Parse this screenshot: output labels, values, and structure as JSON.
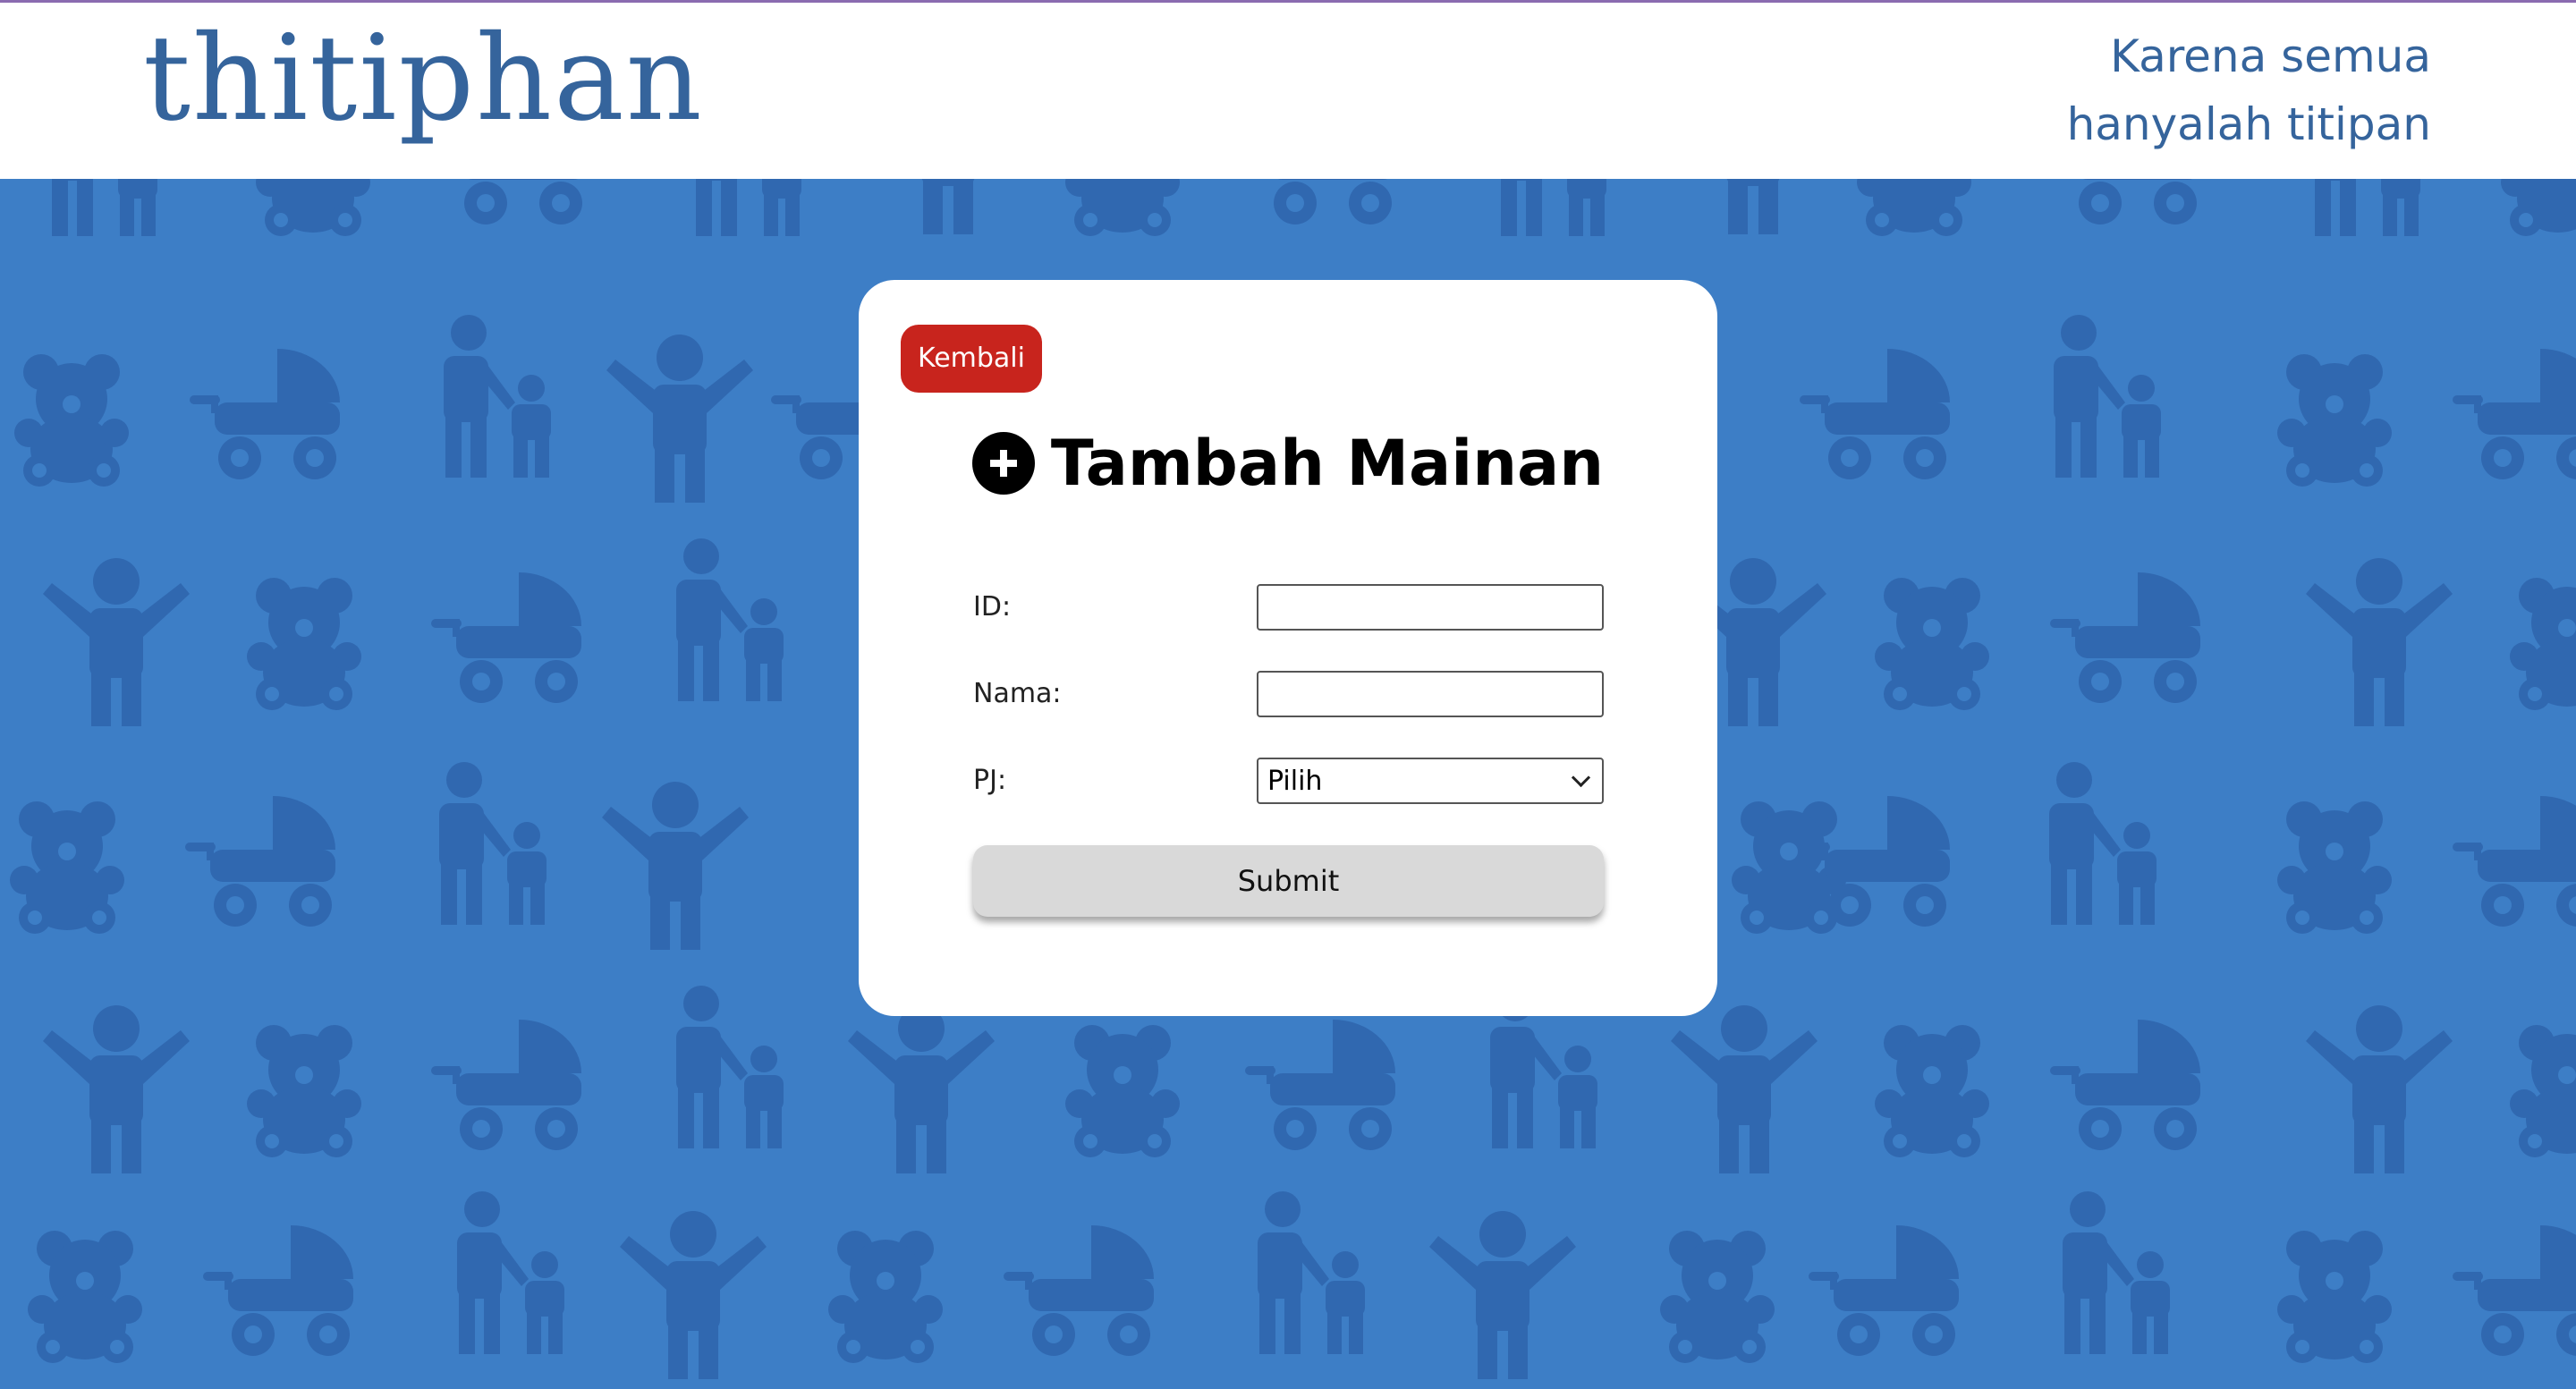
{
  "header": {
    "logo_text": "thitiphan",
    "tagline_line1": "Karena semua",
    "tagline_line2": "hanyalah titipan"
  },
  "card": {
    "back_button_label": "Kembali",
    "title": "Tambah Mainan",
    "title_icon": "plus-circle-icon",
    "fields": {
      "id_label": "ID:",
      "id_value": "",
      "nama_label": "Nama:",
      "nama_value": "",
      "pj_label": "PJ:",
      "pj_selected": "Pilih"
    },
    "submit_label": "Submit"
  },
  "background": {
    "pattern_icons": [
      "teddy-bear-icon",
      "stroller-icon",
      "parent-child-icon",
      "child-arms-up-icon"
    ]
  },
  "colors": {
    "background": "#3d7ec6",
    "pattern_icon": "#3068b0",
    "brand": "#35649c",
    "back_button": "#c8241d",
    "submit_button": "#d9d9d9"
  }
}
